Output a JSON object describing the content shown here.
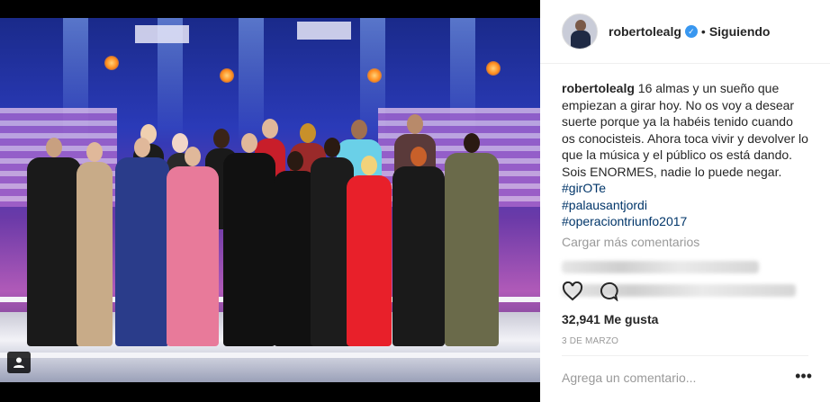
{
  "post": {
    "username": "robertolealg",
    "follow_status": "Siguiendo",
    "separator": "•",
    "caption": "16 almas y un sueño que empiezan a girar hoy. No os voy a desear suerte porque ya la habéis tenido cuando os conocisteis. Ahora toca vivir y devolver lo que la música y el público os está dando. Sois ENORMES, nadie lo puede negar.",
    "hashtags": [
      "#girOTe",
      "#palausantjordi",
      "#operaciontriunfo2017"
    ],
    "load_more": "Cargar más comentarios",
    "likes": "32,941 Me gusta",
    "date": "3 DE MARZO",
    "add_comment_placeholder": "Agrega un comentario...",
    "more_options": "•••"
  },
  "icons": {
    "like": "heart-icon",
    "comment": "comment-icon",
    "verified": "verified-badge-icon",
    "user_tag": "user-tag-icon"
  },
  "colors": {
    "verified": "#3897f0",
    "hashtag": "#003569",
    "muted": "#999999"
  }
}
